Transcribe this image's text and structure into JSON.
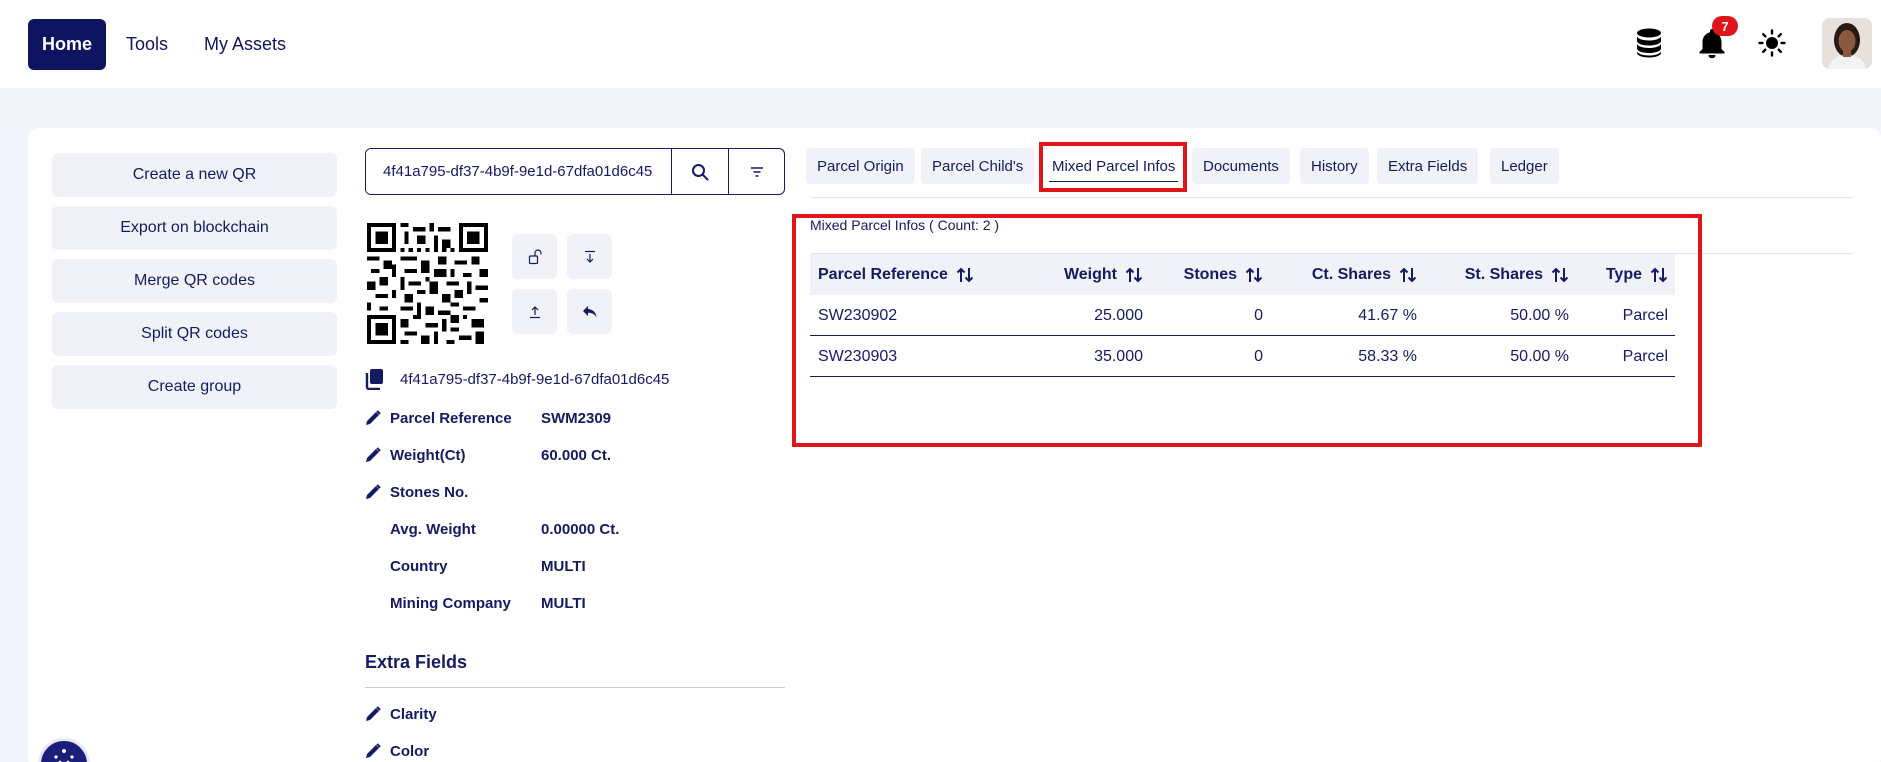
{
  "nav": {
    "items": [
      {
        "label": "Home",
        "active": true
      },
      {
        "label": "Tools",
        "active": false
      },
      {
        "label": "My Assets",
        "active": false
      }
    ],
    "notifications_count": "7",
    "icons": [
      "database-icon",
      "bell-icon",
      "sun-icon"
    ]
  },
  "actions": [
    {
      "label": "Create a new QR"
    },
    {
      "label": "Export on blockchain"
    },
    {
      "label": "Merge QR codes"
    },
    {
      "label": "Split QR codes"
    },
    {
      "label": "Create group"
    }
  ],
  "search": {
    "value": "4f41a795-df37-4b9f-9e1d-67dfa01d6c45"
  },
  "parcel": {
    "uuid": "4f41a795-df37-4b9f-9e1d-67dfa01d6c45",
    "fields": [
      {
        "label": "Parcel Reference",
        "value": "SWM2309",
        "editable": true
      },
      {
        "label": "Weight(Ct)",
        "value": "60.000 Ct.",
        "editable": true
      },
      {
        "label": "Stones No.",
        "value": "",
        "editable": true
      },
      {
        "label": "Avg. Weight",
        "value": "0.00000 Ct.",
        "editable": false
      },
      {
        "label": "Country",
        "value": "MULTI",
        "editable": false
      },
      {
        "label": "Mining Company",
        "value": "MULTI",
        "editable": false
      }
    ]
  },
  "extra_fields": {
    "title": "Extra Fields",
    "items": [
      {
        "label": "Clarity"
      },
      {
        "label": "Color"
      }
    ]
  },
  "tabs": [
    {
      "label": "Parcel Origin",
      "active": false
    },
    {
      "label": "Parcel Child's",
      "active": false
    },
    {
      "label": "Mixed Parcel Infos",
      "active": true
    },
    {
      "label": "Documents",
      "active": false
    },
    {
      "label": "History",
      "active": false
    },
    {
      "label": "Extra Fields",
      "active": false
    },
    {
      "label": "Ledger",
      "active": false
    }
  ],
  "mixed": {
    "count_label": "Mixed Parcel Infos ( Count: 2 )",
    "headers": [
      "Parcel Reference",
      "Weight",
      "Stones",
      "Ct. Shares",
      "St. Shares",
      "Type"
    ],
    "rows": [
      [
        "SW230902",
        "25.000",
        "0",
        "41.67 %",
        "50.00 %",
        "Parcel"
      ],
      [
        "SW230903",
        "35.000",
        "0",
        "58.33 %",
        "50.00 %",
        "Parcel"
      ]
    ]
  },
  "colors": {
    "primary": "#0f1461",
    "highlight": "#e0151a",
    "badge": "#e0151a",
    "surface": "#f0f2f8"
  }
}
